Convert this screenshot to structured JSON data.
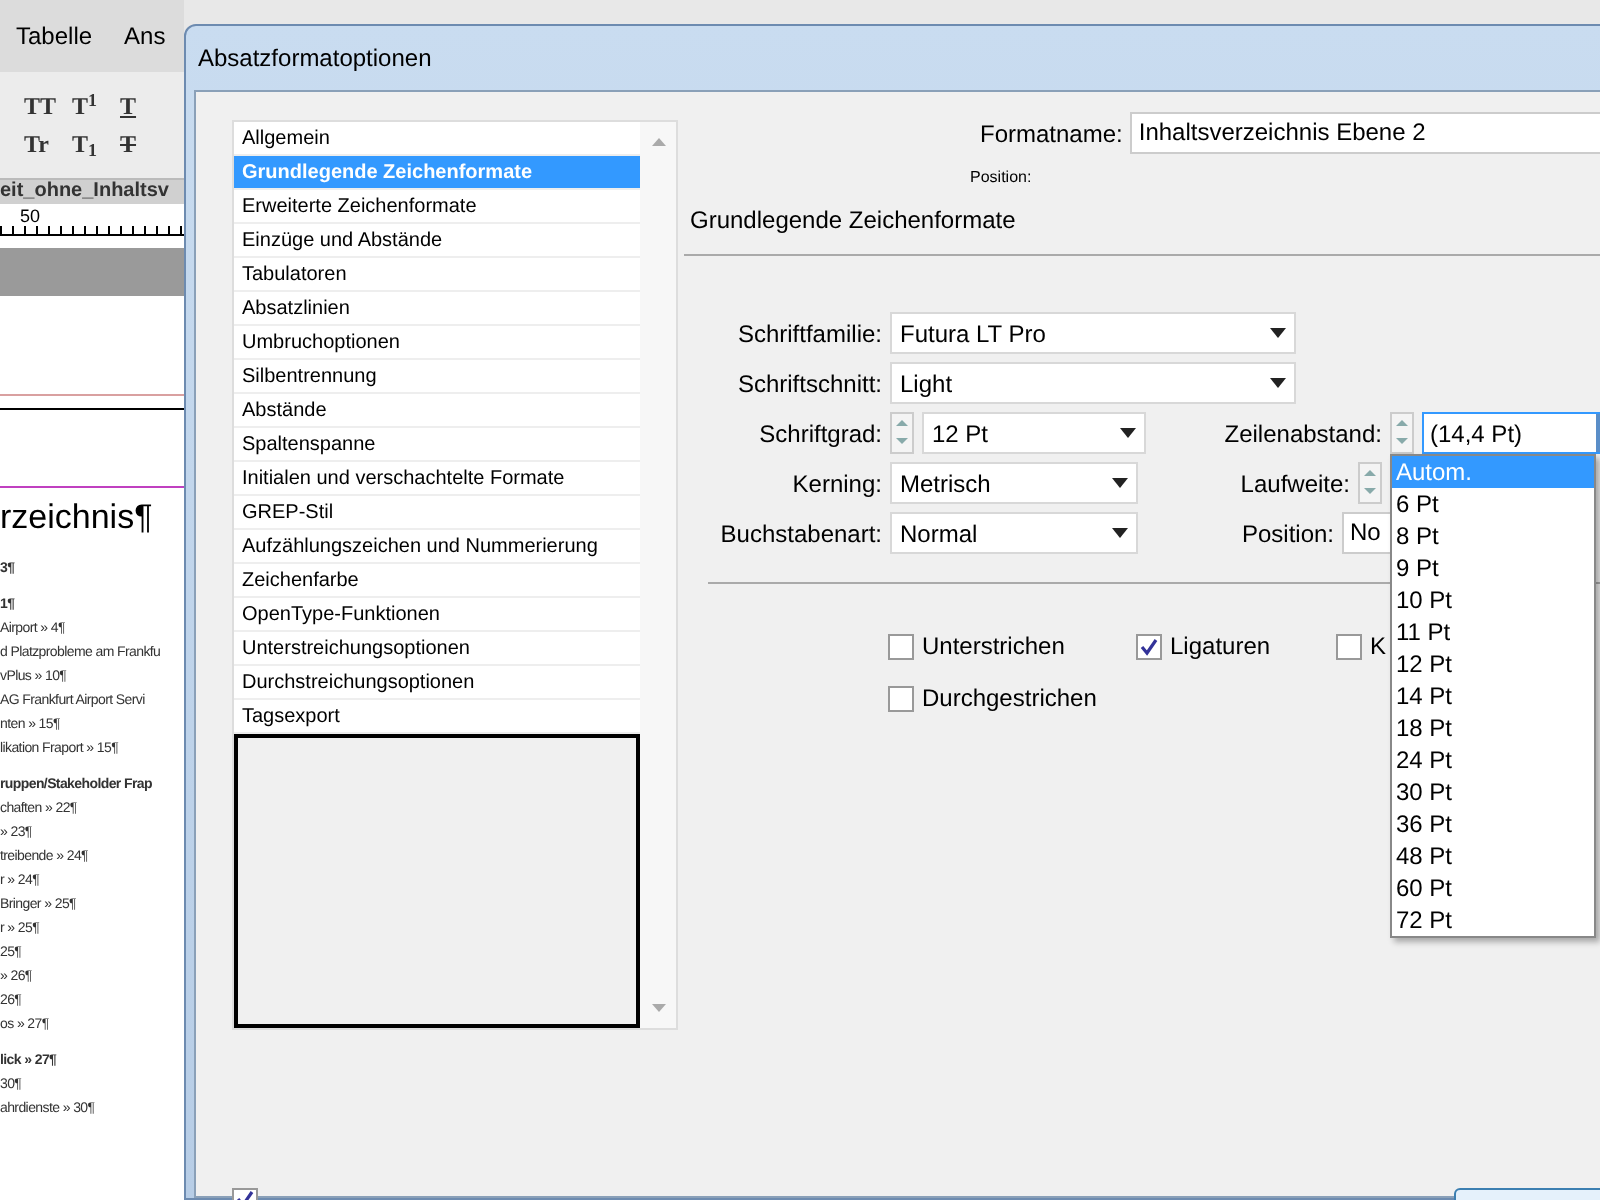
{
  "background_app": {
    "menu": [
      "Tabelle",
      "Ans"
    ],
    "toolbar_buttons": [
      {
        "label": "TT",
        "kind": "plain"
      },
      {
        "label": "T$^{1}$",
        "kind": "plain"
      },
      {
        "label": "T",
        "kind": "underline"
      },
      {
        "label": "Tr",
        "kind": "plain"
      },
      {
        "label": "T$_{1}$",
        "kind": "plain"
      },
      {
        "label": "T",
        "kind": "strike"
      }
    ],
    "document_tab": "eit_ohne_Inhaltsv",
    "ruler_mark": "50",
    "heading": "rzeichnis¶",
    "lines": [
      {
        "text": "3¶",
        "bold": true
      },
      {
        "text": "1¶",
        "bold": true
      },
      {
        "text": "Airport » 4¶",
        "bold": false
      },
      {
        "text": "d Platzprobleme am Frankfu",
        "bold": false
      },
      {
        "text": "vPlus » 10¶",
        "bold": false
      },
      {
        "text": "AG Frankfurt Airport Servi",
        "bold": false
      },
      {
        "text": "nten » 15¶",
        "bold": false
      },
      {
        "text": "likation Fraport » 15¶",
        "bold": false
      },
      {
        "text": "ruppen/Stakeholder Frap",
        "bold": true
      },
      {
        "text": "chaften » 22¶",
        "bold": false
      },
      {
        "text": "» 23¶",
        "bold": false
      },
      {
        "text": "treibende » 24¶",
        "bold": false
      },
      {
        "text": "r » 24¶",
        "bold": false
      },
      {
        "text": "Bringer » 25¶",
        "bold": false
      },
      {
        "text": "r » 25¶",
        "bold": false
      },
      {
        "text": "25¶",
        "bold": false
      },
      {
        "text": "» 26¶",
        "bold": false
      },
      {
        "text": "26¶",
        "bold": false
      },
      {
        "text": "os » 27¶",
        "bold": false
      },
      {
        "text": "lick » 27¶",
        "bold": true
      },
      {
        "text": "30¶",
        "bold": false
      },
      {
        "text": "ahrdienste » 30¶",
        "bold": false
      }
    ]
  },
  "window": {
    "title": "Absatzformatoptionen"
  },
  "sidebar": {
    "items": [
      {
        "label": "Allgemein",
        "selected": false
      },
      {
        "label": "Grundlegende Zeichenformate",
        "selected": true
      },
      {
        "label": "Erweiterte Zeichenformate",
        "selected": false
      },
      {
        "label": "Einzüge und Abstände",
        "selected": false
      },
      {
        "label": "Tabulatoren",
        "selected": false
      },
      {
        "label": "Absatzlinien",
        "selected": false
      },
      {
        "label": "Umbruchoptionen",
        "selected": false
      },
      {
        "label": "Silbentrennung",
        "selected": false
      },
      {
        "label": "Abstände",
        "selected": false
      },
      {
        "label": "Spaltenspanne",
        "selected": false
      },
      {
        "label": "Initialen und verschachtelte Formate",
        "selected": false
      },
      {
        "label": "GREP-Stil",
        "selected": false
      },
      {
        "label": "Aufzählungszeichen und Nummerierung",
        "selected": false
      },
      {
        "label": "Zeichenfarbe",
        "selected": false
      },
      {
        "label": "OpenType-Funktionen",
        "selected": false
      },
      {
        "label": "Unterstreichungsoptionen",
        "selected": false
      },
      {
        "label": "Durchstreichungsoptionen",
        "selected": false
      },
      {
        "label": "Tagsexport",
        "selected": false
      }
    ]
  },
  "format_name": {
    "label": "Formatname:",
    "value": "Inhaltsverzeichnis Ebene 2"
  },
  "position_label": "Position:",
  "section_title": "Grundlegende Zeichenformate",
  "fields": {
    "schriftfamilie": {
      "label": "Schriftfamilie:",
      "value": "Futura LT Pro"
    },
    "schriftschnitt": {
      "label": "Schriftschnitt:",
      "value": "Light"
    },
    "schriftgrad": {
      "label": "Schriftgrad:",
      "value": "12 Pt"
    },
    "zeilenabstand": {
      "label": "Zeilenabstand:",
      "value": "(14,4 Pt)",
      "expanded": true
    },
    "kerning": {
      "label": "Kerning:",
      "value": "Metrisch"
    },
    "laufweite": {
      "label": "Laufweite:"
    },
    "buchstabenart": {
      "label": "Buchstabenart:",
      "value": "Normal"
    },
    "position": {
      "label": "Position:",
      "value": "No"
    }
  },
  "checkboxes": [
    {
      "label": "Unterstrichen",
      "checked": false
    },
    {
      "label": "Ligaturen",
      "checked": true
    },
    {
      "label": "K",
      "checked": false
    },
    {
      "label": "Durchgestrichen",
      "checked": false
    }
  ],
  "dropdown_options": [
    {
      "label": "Autom.",
      "selected": true
    },
    {
      "label": "6 Pt",
      "selected": false
    },
    {
      "label": "8 Pt",
      "selected": false
    },
    {
      "label": "9 Pt",
      "selected": false
    },
    {
      "label": "10 Pt",
      "selected": false
    },
    {
      "label": "11 Pt",
      "selected": false
    },
    {
      "label": "12 Pt",
      "selected": false
    },
    {
      "label": "14 Pt",
      "selected": false
    },
    {
      "label": "18 Pt",
      "selected": false
    },
    {
      "label": "24 Pt",
      "selected": false
    },
    {
      "label": "30 Pt",
      "selected": false
    },
    {
      "label": "36 Pt",
      "selected": false
    },
    {
      "label": "48 Pt",
      "selected": false
    },
    {
      "label": "60 Pt",
      "selected": false
    },
    {
      "label": "72 Pt",
      "selected": false
    }
  ],
  "preview": {
    "checked": true
  }
}
